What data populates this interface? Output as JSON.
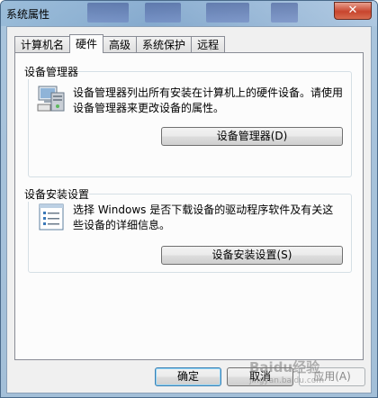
{
  "window": {
    "title": "系统属性",
    "close_glyph": "✕"
  },
  "tabs": [
    {
      "label": "计算机名",
      "active": false
    },
    {
      "label": "硬件",
      "active": true
    },
    {
      "label": "高级",
      "active": false
    },
    {
      "label": "系统保护",
      "active": false
    },
    {
      "label": "远程",
      "active": false
    }
  ],
  "device_manager": {
    "group_label": "设备管理器",
    "icon": "device-manager-icon",
    "description": "设备管理器列出所有安装在计算机上的硬件设备。请使用设备管理器来更改设备的属性。",
    "button_label": "设备管理器(D)"
  },
  "device_installation": {
    "group_label": "设备安装设置",
    "icon": "checklist-icon",
    "description": "选择 Windows 是否下载设备的驱动程序软件及有关这些设备的详细信息。",
    "button_label": "设备安装设置(S)"
  },
  "footer": {
    "ok_label": "确定",
    "cancel_label": "取消",
    "apply_label": "应用(A)"
  },
  "watermark": {
    "text": "Baidu经验",
    "subtext": "jingyan.baidu.com"
  },
  "colors": {
    "title_bar": "#a9c4dc",
    "panel": "#fcfcfc",
    "default_button_border": "#3c7fb1"
  }
}
